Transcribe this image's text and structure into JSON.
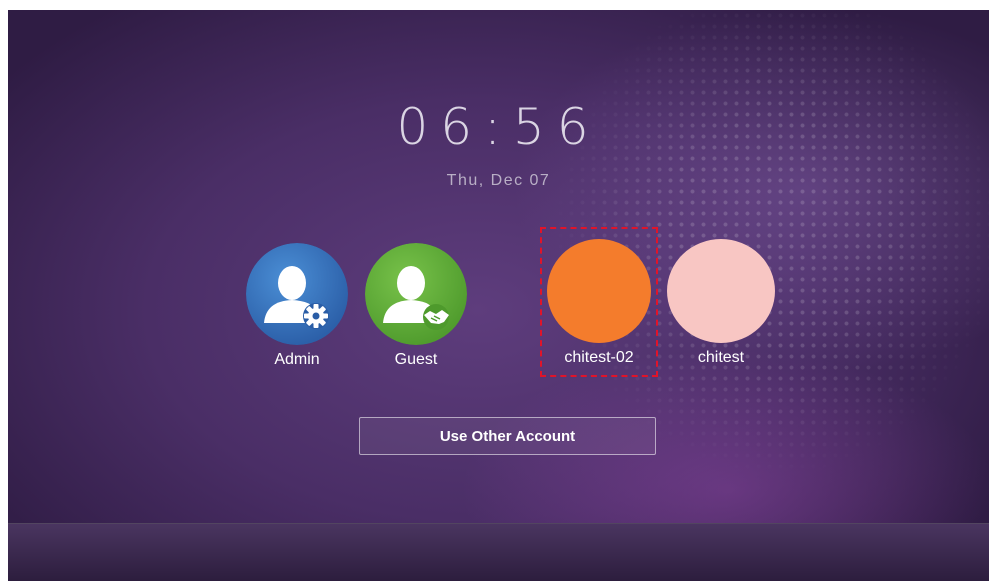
{
  "clock": {
    "time": "06:56",
    "date": "Thu, Dec 07"
  },
  "users": [
    {
      "label": "Admin",
      "icon": "admin-user-icon",
      "color": "#2f6fba"
    },
    {
      "label": "Guest",
      "icon": "guest-user-icon",
      "color": "#5aa632"
    },
    {
      "label": "chitest-02",
      "icon": "avatar-placeholder",
      "color": "#f47c2c",
      "selected": true
    },
    {
      "label": "chitest",
      "icon": "avatar-placeholder",
      "color": "#f8c6c3"
    }
  ],
  "actions": {
    "other_account_label": "Use Other Account"
  },
  "colors": {
    "selection_outline": "#e0142a",
    "background": "#4a2e66"
  }
}
